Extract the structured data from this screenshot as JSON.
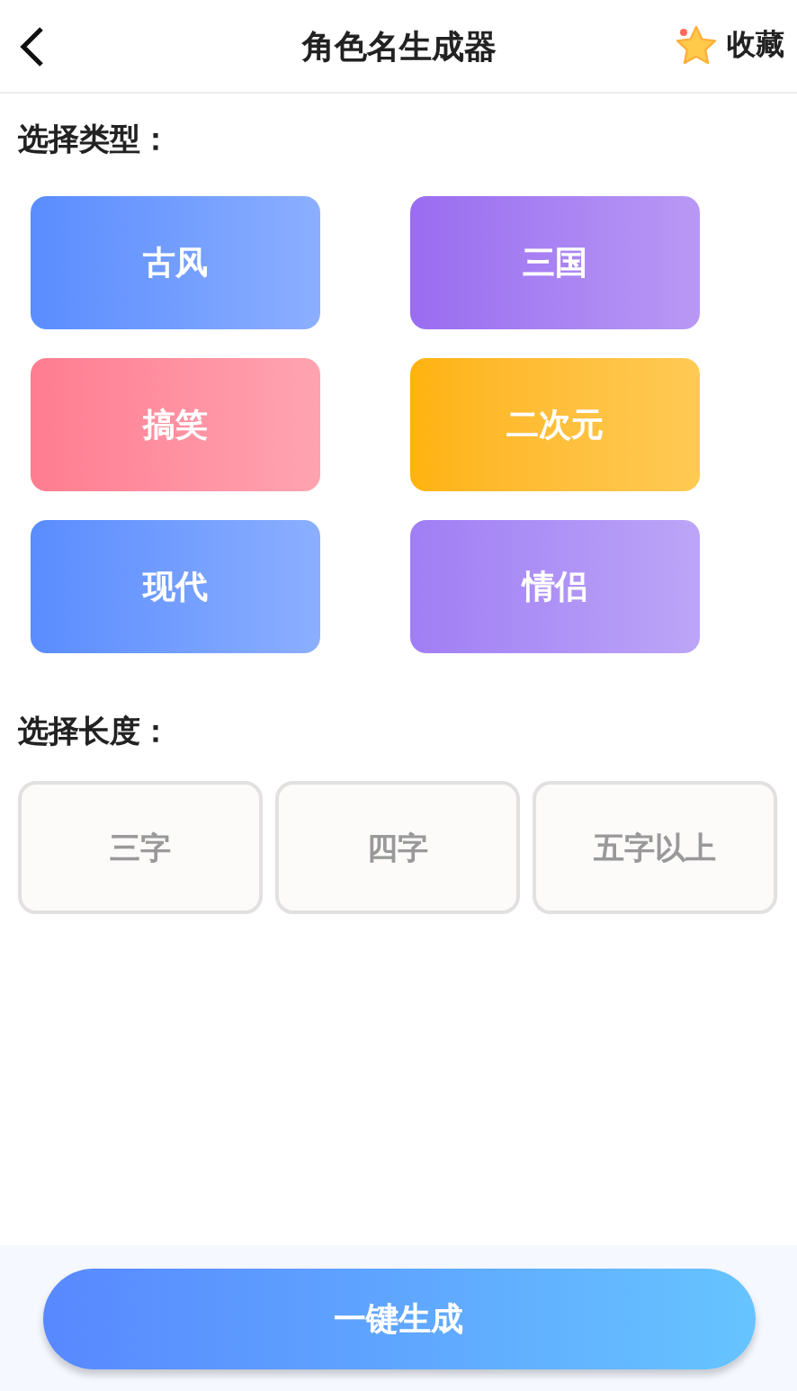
{
  "header": {
    "title": "角色名生成器",
    "favorite": "收藏"
  },
  "type_section": {
    "label": "选择类型：",
    "options": [
      {
        "label": "古风",
        "color": "#5a8cff"
      },
      {
        "label": "三国",
        "color": "#9a6cf0"
      },
      {
        "label": "搞笑",
        "color": "#ff7c90"
      },
      {
        "label": "二次元",
        "color": "#ffb30a"
      },
      {
        "label": "现代",
        "color": "#5a8cff"
      },
      {
        "label": "情侣",
        "color": "#a07ef4"
      }
    ]
  },
  "length_section": {
    "label": "选择长度：",
    "options": [
      {
        "label": "三字"
      },
      {
        "label": "四字"
      },
      {
        "label": "五字以上"
      }
    ]
  },
  "generate_button": "一键生成"
}
